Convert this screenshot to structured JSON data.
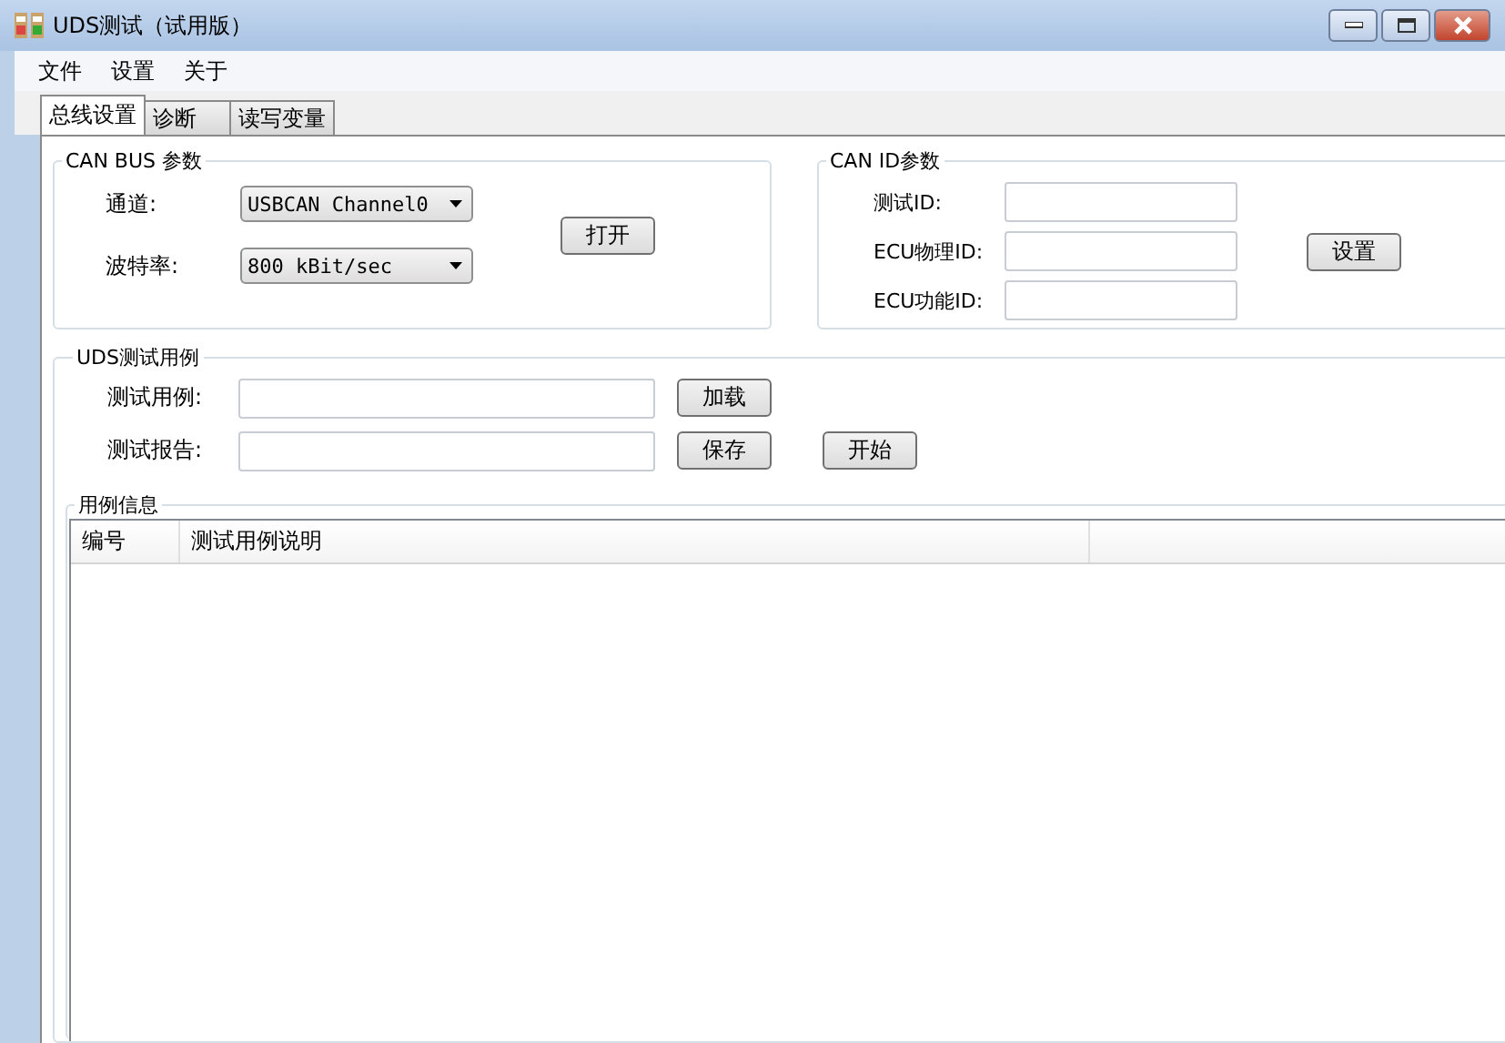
{
  "window": {
    "title": "UDS测试（试用版）"
  },
  "menu": [
    "文件",
    "设置",
    "关于"
  ],
  "tabs": [
    {
      "label": "总线设置",
      "selected": true
    },
    {
      "label": "诊断",
      "selected": false
    },
    {
      "label": "读写变量",
      "selected": false
    }
  ],
  "can_bus": {
    "title": "CAN BUS 参数",
    "channel_label": "通道:",
    "channel_value": "USBCAN Channel0",
    "baud_label": "波特率:",
    "baud_value": "800 kBit/sec",
    "open_button": "打开"
  },
  "can_id": {
    "title": "CAN ID参数",
    "fields": [
      {
        "label": "测试ID:"
      },
      {
        "label": "ECU物理ID:"
      },
      {
        "label": "ECU功能ID:"
      }
    ],
    "set_button": "设置"
  },
  "uds_case": {
    "title": "UDS测试用例",
    "case_label": "测试用例:",
    "load_button": "加载",
    "report_label": "测试报告:",
    "save_button": "保存",
    "start_button": "开始"
  },
  "case_info": {
    "title": "用例信息",
    "columns": [
      "编号",
      "测试用例说明"
    ]
  }
}
